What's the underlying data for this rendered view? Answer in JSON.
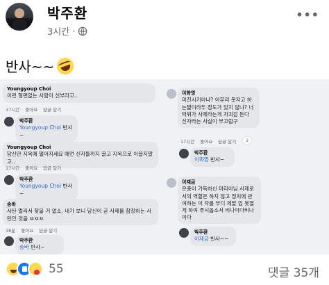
{
  "post": {
    "author": "박주환",
    "time": "3시간",
    "dot": "·",
    "privacy_icon": "globe-icon",
    "more_icon": "more-options-icon",
    "more_glyph": "•••",
    "text": "반사~~",
    "emoji": "rolling-laughing-emoji"
  },
  "screenshot_comments": {
    "left": [
      {
        "name": "Youngyoup Choi",
        "text": "이런 형편없는 사람이 신부라고..",
        "time": "17시간",
        "like": "좋아요",
        "reply": "답글 달기"
      },
      {
        "name": "박주환",
        "mention": "Youngyoup Choi",
        "text": "반사~",
        "time": "",
        "like": "",
        "reply": ""
      },
      {
        "name": "Youngyoup Choi",
        "text": "당신만 지옥에 떨어지세요 애먼 신자들까지 끌고 지옥으로 이끌지말고..",
        "time": "17시간",
        "like": "좋아요",
        "reply": "답글 달기"
      },
      {
        "name": "박주환",
        "mention": "Youngyoup Choi",
        "text": "반사~",
        "time": "",
        "like": "",
        "reply": ""
      },
      {
        "name": "송바",
        "text": "사탄 멀리서 찾을 거 없소. 내가 보니 당신이 곧 사제를 참칭하는 사탄인 것을 ㅉㅉㅉ",
        "time": "38분",
        "like": "좋아요",
        "reply": "답글 달기"
      },
      {
        "name": "박주환",
        "mention": "송바",
        "text": "반사~",
        "time": "",
        "like": "",
        "reply": ""
      }
    ],
    "right": [
      {
        "name": "이화영",
        "text": "미친시키아냐? 아무리 못자고 하는짤이라두 정도가 있지 않냐? 너따위가 사제라는게 자괴감 든다 신자라는 사실이 부끄럽구",
        "time": "17시간",
        "like": "좋아요",
        "reply": "답글 달기",
        "react": "2"
      },
      {
        "name": "박주환",
        "mention": "이화영",
        "text": "반사~",
        "time": "",
        "like": "",
        "reply": ""
      },
      {
        "name": "이재금",
        "text": "은총이 가득하신 마리아님 사제로서의 역할은 하지 않고 정치에 관여하는 이 자를 부디 제발 입 못열게 하여 주시옵소서 비나이다비나이다",
        "time": "",
        "like": "",
        "reply": ""
      },
      {
        "name": "박주환",
        "mention": "이재금",
        "text": "반사~~",
        "time": "",
        "like": "",
        "reply": ""
      }
    ]
  },
  "footer": {
    "reaction_icons": [
      "haha-reaction-icon",
      "like-reaction-icon",
      "care-reaction-icon"
    ],
    "reaction_count": "55",
    "comments_label": "댓글 35개"
  }
}
